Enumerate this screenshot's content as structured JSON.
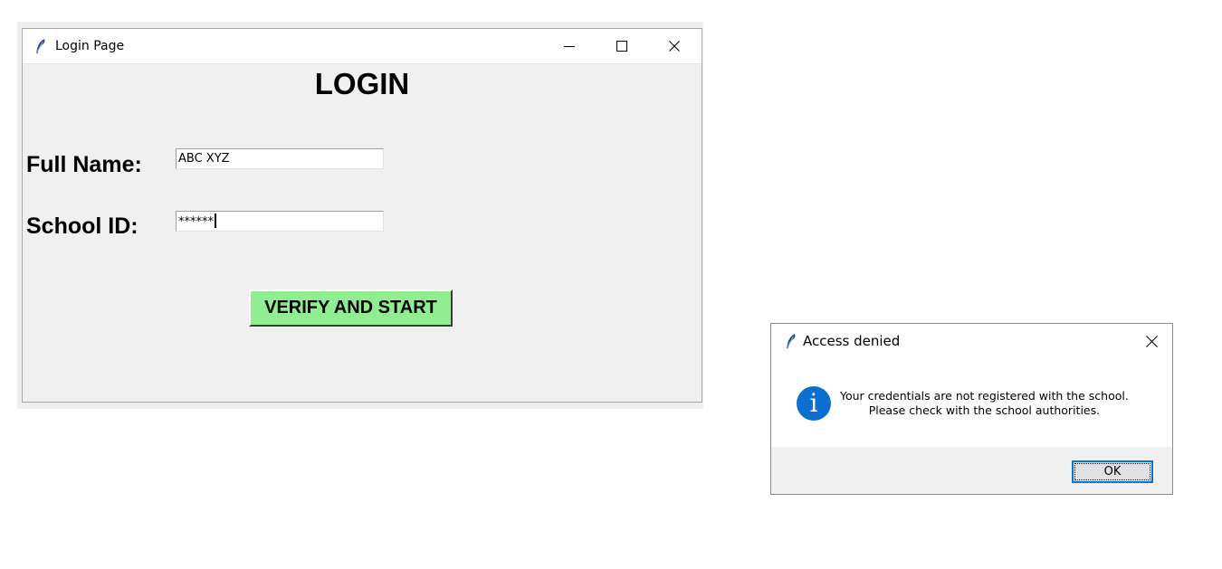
{
  "login_window": {
    "title": "Login Page",
    "heading": "LOGIN",
    "full_name_label": "Full Name:",
    "full_name_value": "ABC XYZ",
    "school_id_label": "School ID:",
    "school_id_value": "******",
    "verify_button": "VERIFY AND START",
    "icon": "feather-icon",
    "verify_button_color": "#90ee90"
  },
  "dialog": {
    "title": "Access denied",
    "message_line1": "Your credentials are not registered with the school.",
    "message_line2": "Please check with the school authorities.",
    "ok_label": "OK",
    "icon": "info-icon",
    "accent": "#0078d7"
  }
}
